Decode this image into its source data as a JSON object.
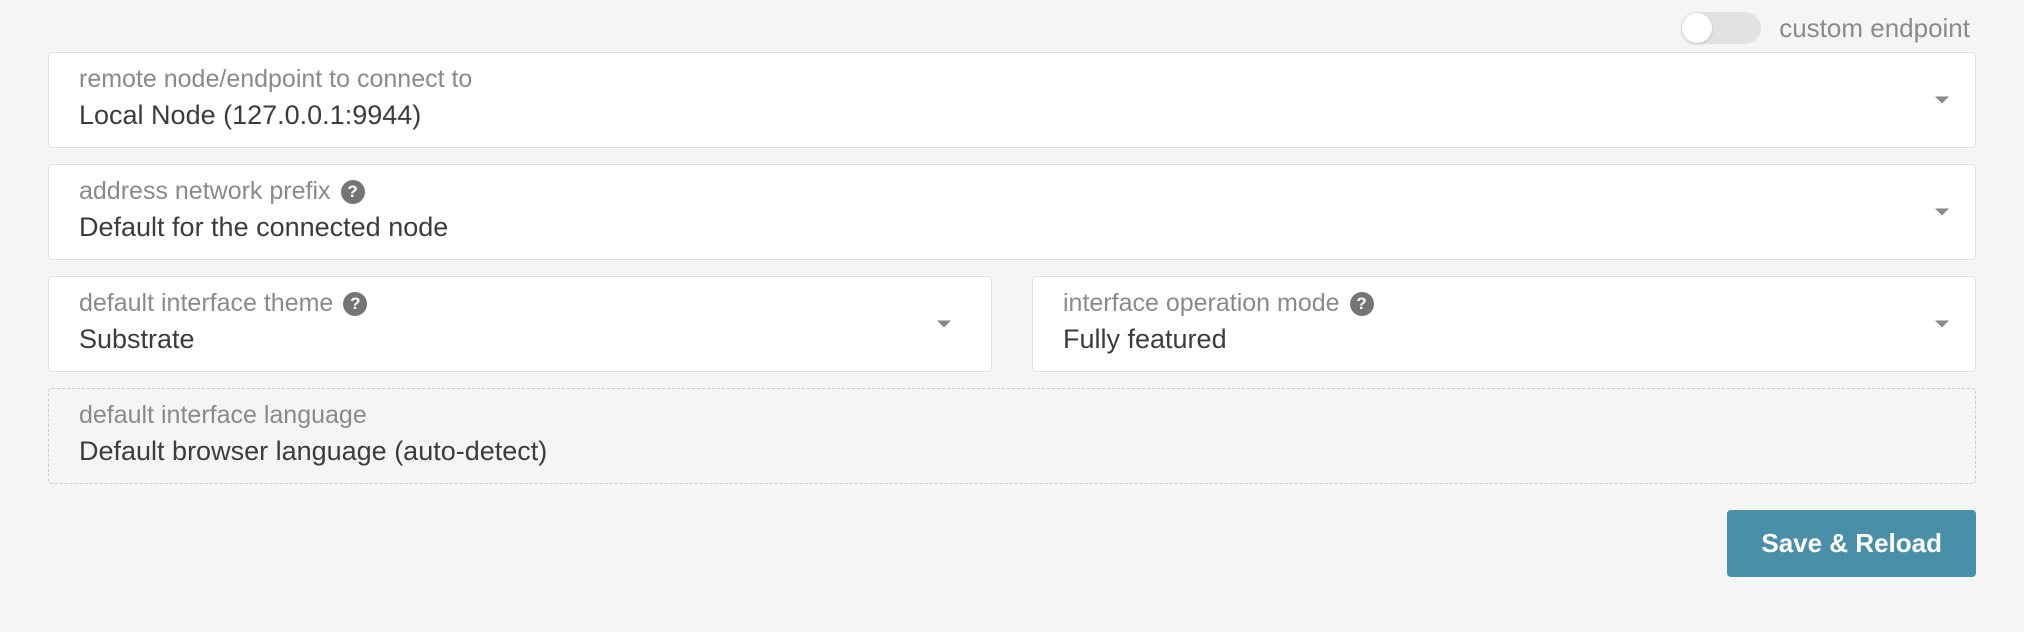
{
  "toggle": {
    "label": "custom endpoint"
  },
  "endpoint": {
    "label": "remote node/endpoint to connect to",
    "value": "Local Node (127.0.0.1:9944)"
  },
  "prefix": {
    "label": "address network prefix",
    "value": "Default for the connected node"
  },
  "theme": {
    "label": "default interface theme",
    "value": "Substrate"
  },
  "mode": {
    "label": "interface operation mode",
    "value": "Fully featured"
  },
  "language": {
    "label": "default interface language",
    "value": "Default browser language (auto-detect)"
  },
  "actions": {
    "save_label": "Save & Reload"
  }
}
